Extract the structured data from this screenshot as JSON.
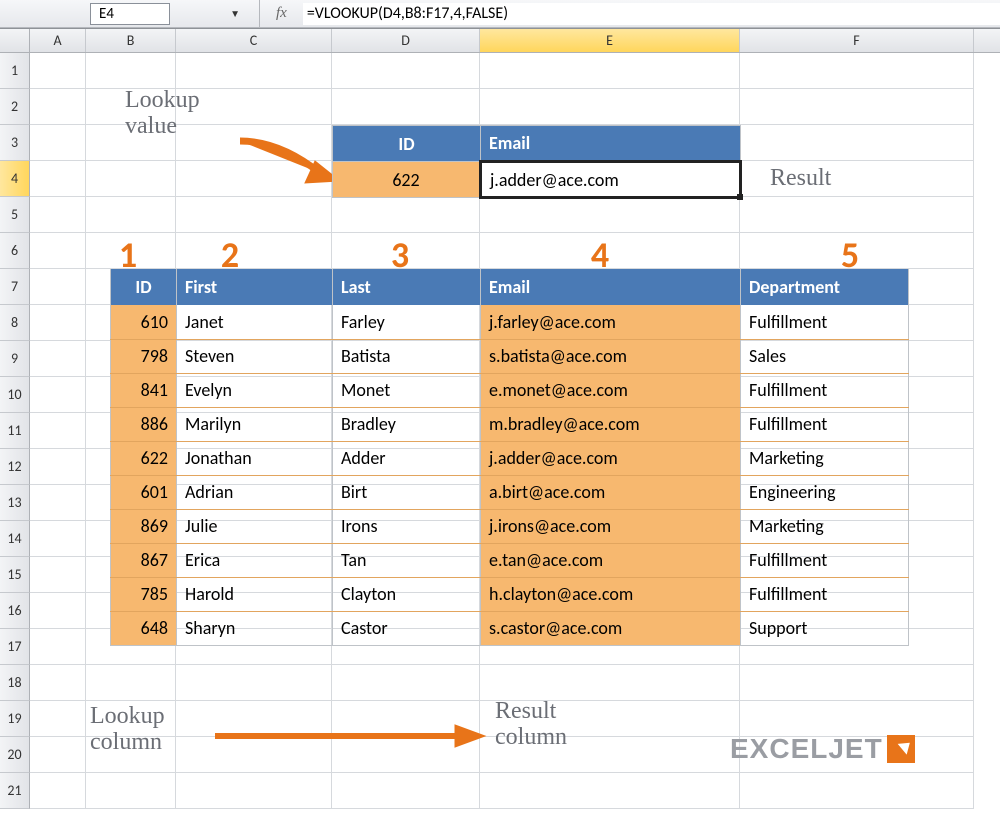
{
  "name_box": "E4",
  "formula": "=VLOOKUP(D4,B8:F17,4,FALSE)",
  "fx_label": "fx",
  "columns": [
    "A",
    "B",
    "C",
    "D",
    "E",
    "F"
  ],
  "active_column": "E",
  "rows": [
    "1",
    "2",
    "3",
    "4",
    "5",
    "6",
    "7",
    "8",
    "9",
    "10",
    "11",
    "12",
    "13",
    "14",
    "15",
    "16",
    "17",
    "18",
    "19",
    "20",
    "21"
  ],
  "active_row": "4",
  "annotations": {
    "lookup_value": "Lookup\nvalue",
    "result": "Result",
    "lookup_column": "Lookup\ncolumn",
    "result_column": "Result\ncolumn"
  },
  "column_numbers": [
    "1",
    "2",
    "3",
    "4",
    "5"
  ],
  "lookup_box": {
    "headers": {
      "id": "ID",
      "email": "Email"
    },
    "id": "622",
    "email": "j.adder@ace.com"
  },
  "data_table": {
    "headers": {
      "id": "ID",
      "first": "First",
      "last": "Last",
      "email": "Email",
      "dept": "Department"
    },
    "rows": [
      {
        "id": "610",
        "first": "Janet",
        "last": "Farley",
        "email": "j.farley@ace.com",
        "dept": "Fulfillment"
      },
      {
        "id": "798",
        "first": "Steven",
        "last": "Batista",
        "email": "s.batista@ace.com",
        "dept": "Sales"
      },
      {
        "id": "841",
        "first": "Evelyn",
        "last": "Monet",
        "email": "e.monet@ace.com",
        "dept": "Fulfillment"
      },
      {
        "id": "886",
        "first": "Marilyn",
        "last": "Bradley",
        "email": "m.bradley@ace.com",
        "dept": "Fulfillment"
      },
      {
        "id": "622",
        "first": "Jonathan",
        "last": "Adder",
        "email": "j.adder@ace.com",
        "dept": "Marketing"
      },
      {
        "id": "601",
        "first": "Adrian",
        "last": "Birt",
        "email": "a.birt@ace.com",
        "dept": "Engineering"
      },
      {
        "id": "869",
        "first": "Julie",
        "last": "Irons",
        "email": "j.irons@ace.com",
        "dept": "Marketing"
      },
      {
        "id": "867",
        "first": "Erica",
        "last": "Tan",
        "email": "e.tan@ace.com",
        "dept": "Fulfillment"
      },
      {
        "id": "785",
        "first": "Harold",
        "last": "Clayton",
        "email": "h.clayton@ace.com",
        "dept": "Fulfillment"
      },
      {
        "id": "648",
        "first": "Sharyn",
        "last": "Castor",
        "email": "s.castor@ace.com",
        "dept": "Support"
      }
    ]
  },
  "logo_text": "EXCELJET"
}
